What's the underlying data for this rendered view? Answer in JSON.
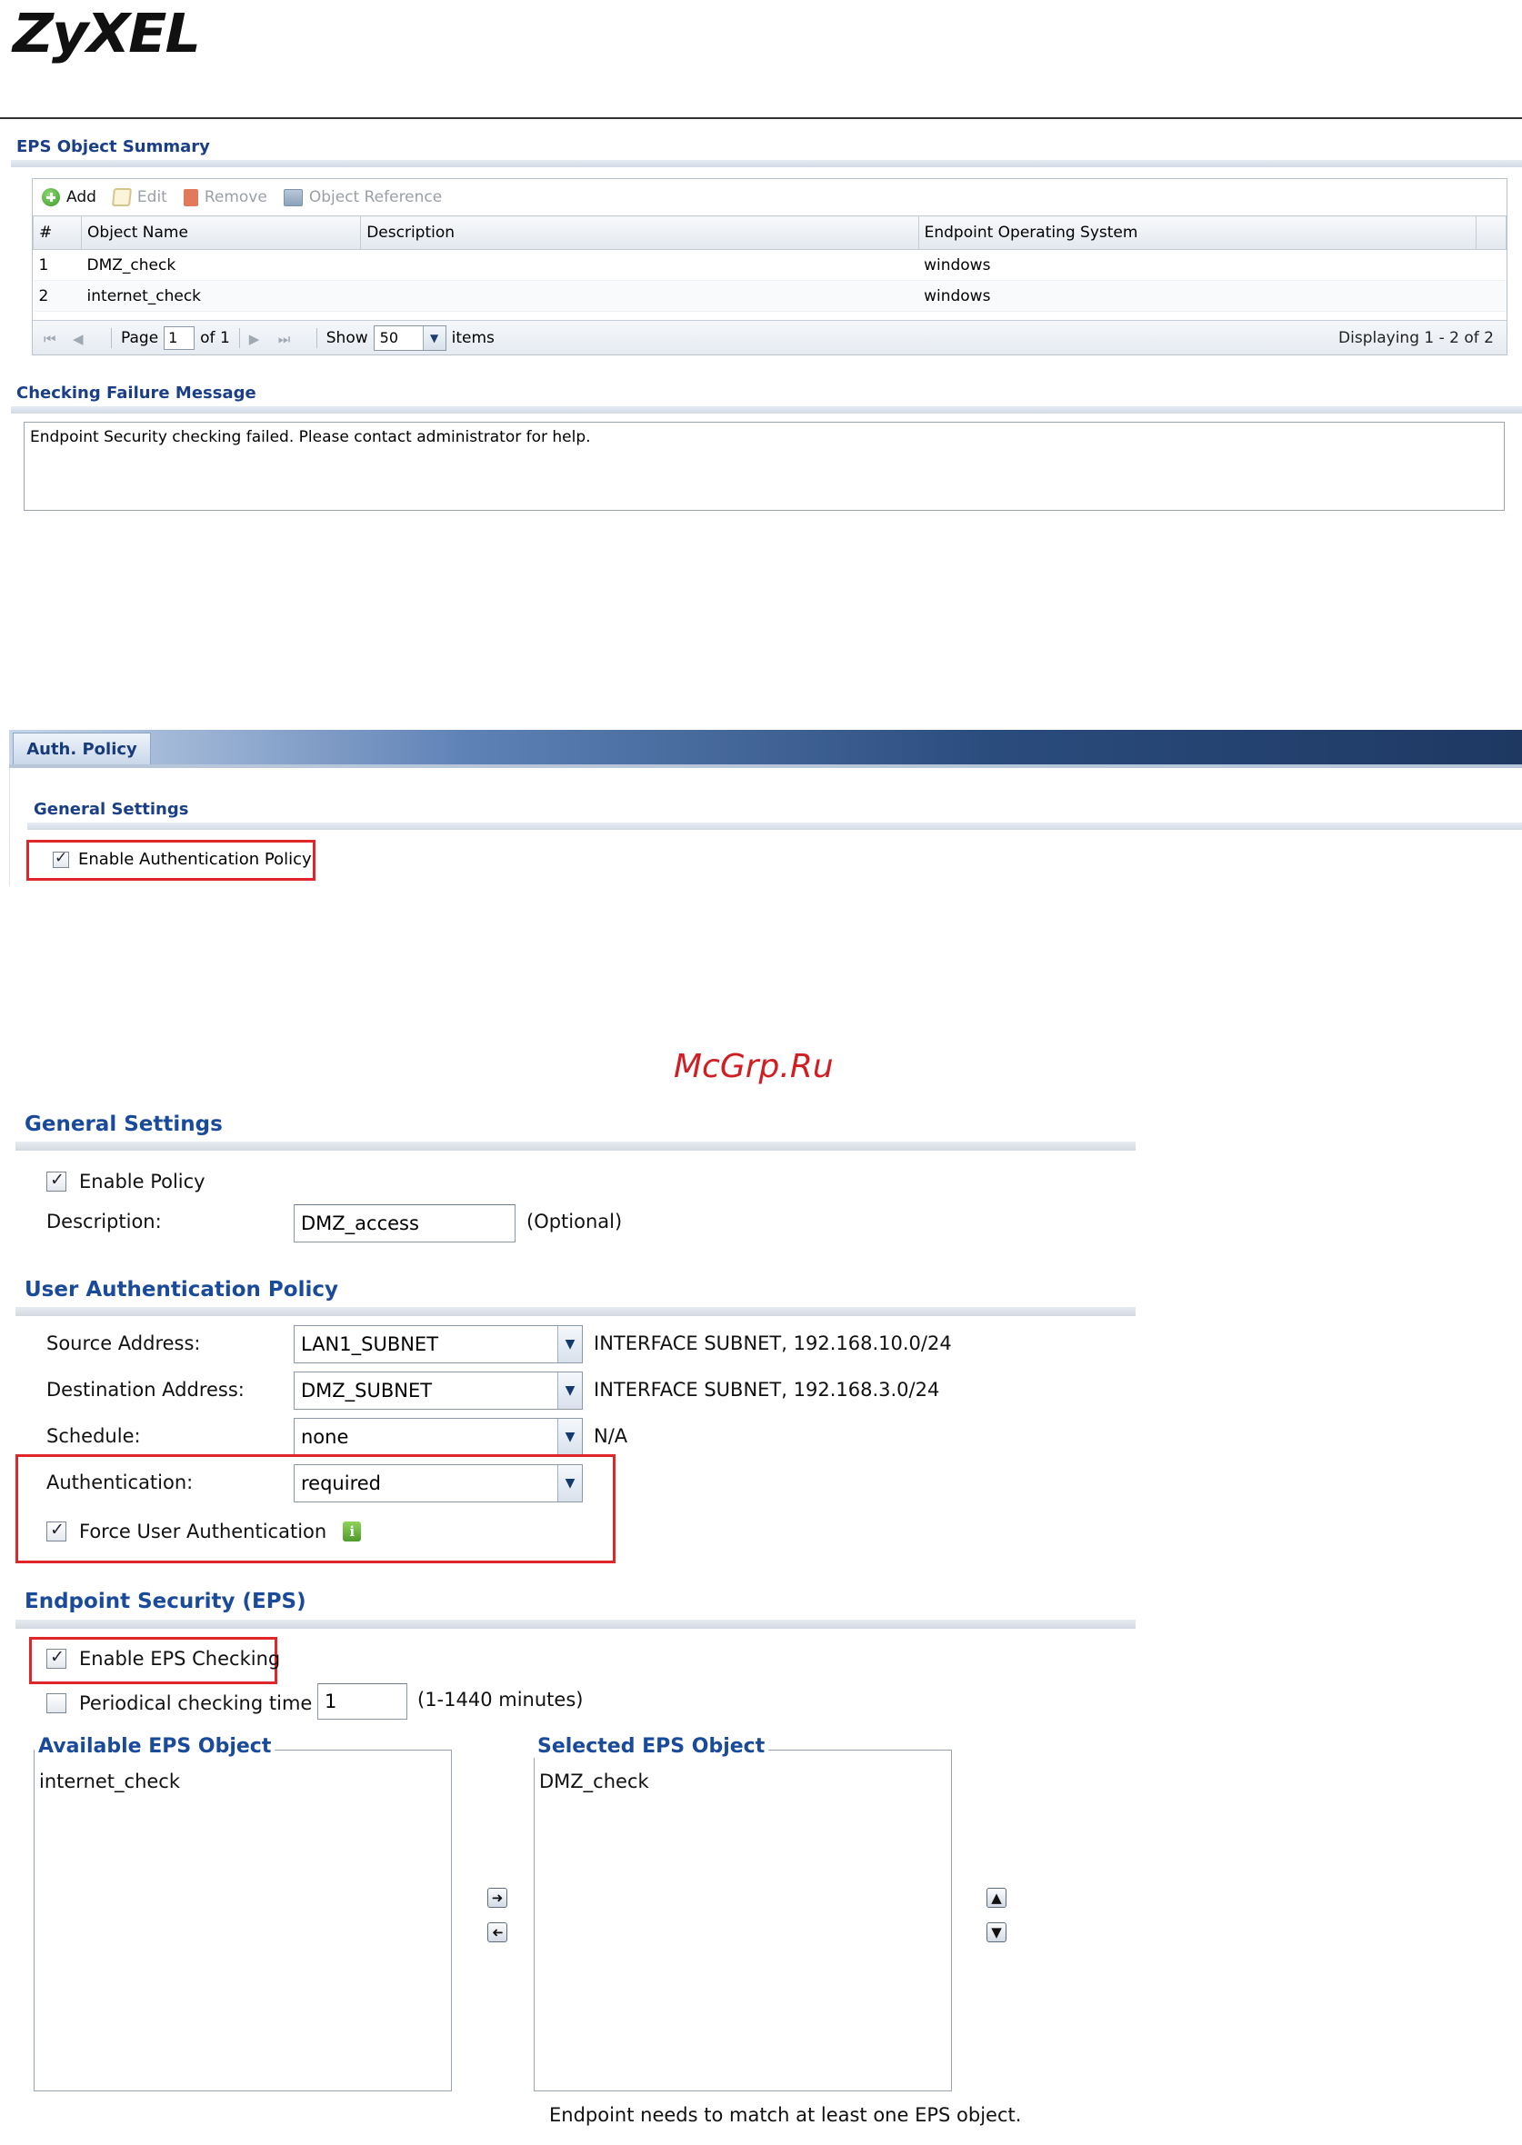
{
  "brand": {
    "logo_text": "ZyXEL"
  },
  "eps_summary": {
    "title": "EPS Object Summary",
    "toolbar": {
      "add": "Add",
      "edit": "Edit",
      "remove": "Remove",
      "object_reference": "Object Reference"
    },
    "columns": [
      "#",
      "Object Name",
      "Description",
      "Endpoint Operating System"
    ],
    "rows": [
      {
        "num": "1",
        "name": "DMZ_check",
        "description": "",
        "os": "windows"
      },
      {
        "num": "2",
        "name": "internet_check",
        "description": "",
        "os": "windows"
      }
    ],
    "pager": {
      "page_label": "Page",
      "page_value": "1",
      "of_label": "of 1",
      "show_label": "Show",
      "show_value": "50",
      "items_label": "items",
      "displaying": "Displaying 1 - 2 of 2"
    }
  },
  "checking_failure": {
    "title": "Checking Failure Message",
    "message": "Endpoint Security checking failed. Please contact administrator for help."
  },
  "auth_policy": {
    "tab_label": "Auth. Policy",
    "general_title": "General Settings",
    "enable_label": "Enable Authentication Policy",
    "enable_checked": true
  },
  "watermark": "McGrp.Ru",
  "policy_form": {
    "general": {
      "title": "General Settings",
      "enable_policy_label": "Enable Policy",
      "enable_policy_checked": true,
      "description_label": "Description:",
      "description_value": "DMZ_access",
      "description_hint": "(Optional)"
    },
    "user_auth": {
      "title": "User Authentication Policy",
      "source_label": "Source Address:",
      "source_value": "LAN1_SUBNET",
      "source_info": "INTERFACE SUBNET, 192.168.10.0/24",
      "dest_label": "Destination Address:",
      "dest_value": "DMZ_SUBNET",
      "dest_info": "INTERFACE SUBNET, 192.168.3.0/24",
      "schedule_label": "Schedule:",
      "schedule_value": "none",
      "schedule_info": "N/A",
      "auth_label": "Authentication:",
      "auth_value": "required",
      "force_label": "Force User Authentication",
      "force_checked": true,
      "info_icon": "i"
    },
    "eps": {
      "title": "Endpoint Security (EPS)",
      "enable_label": "Enable EPS Checking",
      "enable_checked": true,
      "periodical_label": "Periodical checking time",
      "periodical_checked": false,
      "periodical_value": "1",
      "periodical_hint": "(1-1440 minutes)",
      "available_title": "Available EPS Object",
      "available_items": [
        "internet_check"
      ],
      "selected_title": "Selected EPS Object",
      "selected_items": [
        "DMZ_check"
      ],
      "footer_note": "Endpoint needs to match at least one EPS object."
    }
  },
  "colors": {
    "section_title": "#1a3f86",
    "highlight_box": "#e0262b",
    "tab_bar_dark": "#1e3862"
  }
}
